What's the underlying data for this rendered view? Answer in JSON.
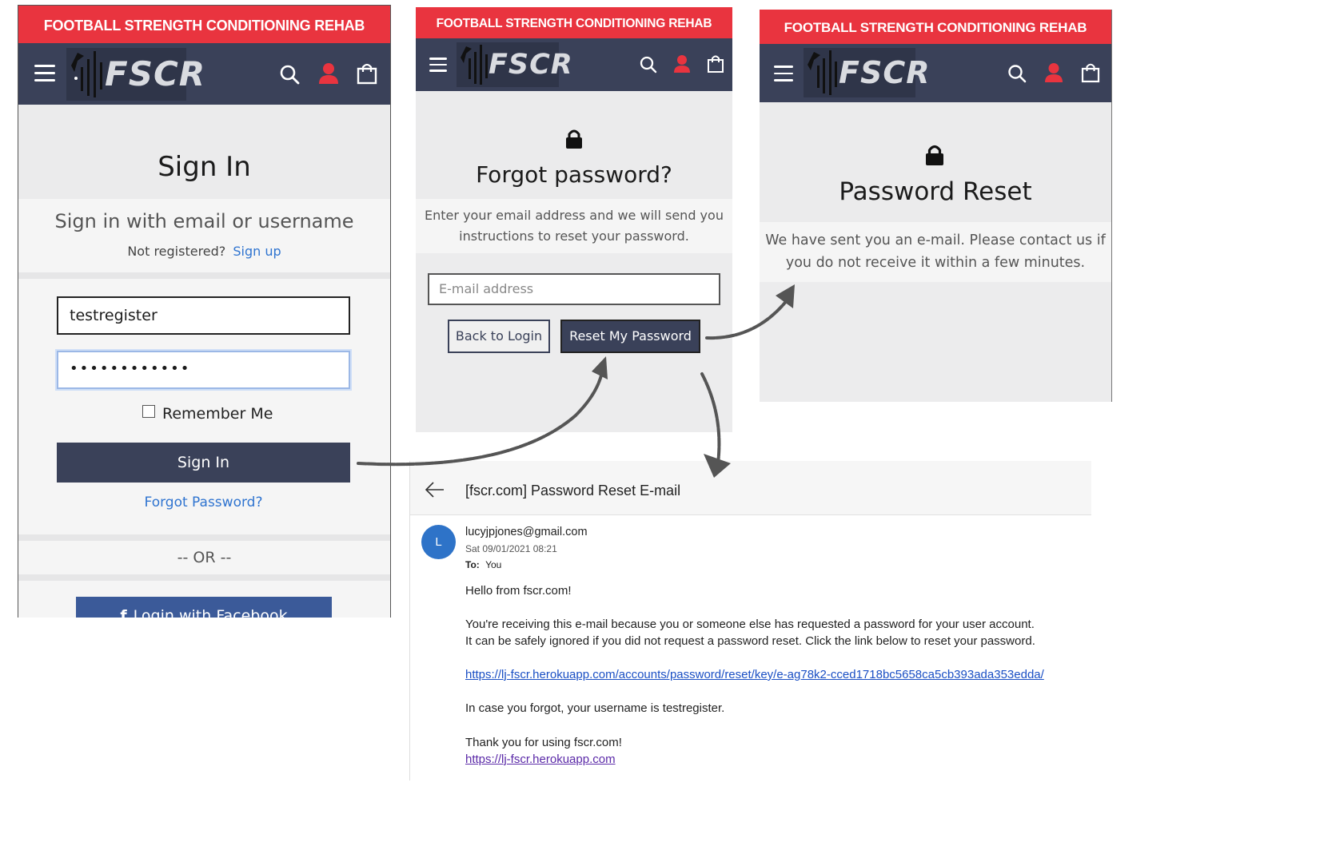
{
  "brand": {
    "banner": "FOOTBALL STRENGTH CONDITIONING REHAB",
    "logo_text": "FSCR",
    "colors": {
      "banner": "#e9343f",
      "navbar": "#3a4159",
      "primary_button": "#3a4159",
      "link": "#2f74d0",
      "user_icon": "#e9343f"
    }
  },
  "nav_icons": [
    "hamburger-menu-icon",
    "search-icon",
    "user-icon",
    "shopping-bag-icon"
  ],
  "signin": {
    "title": "Sign In",
    "subtitle": "Sign in with email or username",
    "not_registered": "Not registered?",
    "signup_link": "Sign up",
    "username_value": "testregister",
    "password_mask": "••••••••••••",
    "remember_me": "Remember Me",
    "signin_button": "Sign In",
    "forgot_link": "Forgot Password?",
    "or_divider": "-- OR --",
    "facebook_button": "Login with Facebook"
  },
  "forgot": {
    "title": "Forgot password?",
    "description_line1": "Enter your email address and we will send you",
    "description_line2": "instructions to reset your password.",
    "email_placeholder": "E-mail address",
    "back_button": "Back to Login",
    "reset_button": "Reset My Password"
  },
  "reset": {
    "title": "Password Reset",
    "message_line1": "We have sent you an e-mail. Please contact us if",
    "message_line2": "you do not receive it within a few minutes."
  },
  "email": {
    "subject": "[fscr.com] Password Reset E-mail",
    "avatar_letter": "L",
    "sender": "lucyjpjones@gmail.com",
    "date": "Sat 09/01/2021 08:21",
    "to_label": "To:",
    "to_value": "You",
    "greeting": "Hello from fscr.com!",
    "body_line1": "You're receiving this e-mail because you or someone else has requested a password for your user account.",
    "body_line2": "It can be safely ignored if you did not request a password reset. Click the link below to reset your password.",
    "reset_link": "https://lj-fscr.herokuapp.com/accounts/password/reset/key/e-ag78k2-cced1718bc5658ca5cb393ada353edda/",
    "username_note": "In case you forgot, your username is testregister.",
    "thanks": "Thank you for using fscr.com!",
    "site_link": "https://lj-fscr.herokuapp.com"
  }
}
